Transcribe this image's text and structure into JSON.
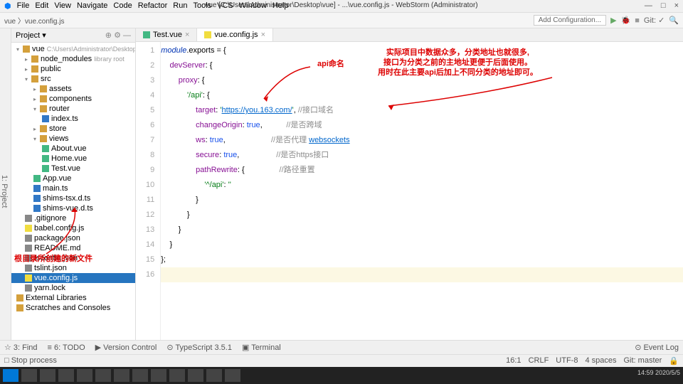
{
  "menu": [
    "File",
    "Edit",
    "View",
    "Navigate",
    "Code",
    "Refactor",
    "Run",
    "Tools",
    "VCS",
    "Window",
    "Help"
  ],
  "title": "vue [C:\\Users\\Administrator\\Desktop\\vue] - ...\\vue.config.js - WebStorm (Administrator)",
  "winbtns": [
    "—",
    "□",
    "×"
  ],
  "breadcrumb": "vue 〉vue.config.js",
  "addConfig": "Add Configuration...",
  "gitLabel": "Git: ✓",
  "projectHdr": "Project ▾",
  "tree": [
    {
      "d": 0,
      "i": "fld",
      "t": "vue",
      "sub": "C:\\Users\\Administrator\\Desktop\\vue",
      "a": "open"
    },
    {
      "d": 1,
      "i": "fld",
      "t": "node_modules",
      "sub": "library root",
      "lib": 1,
      "a": ""
    },
    {
      "d": 1,
      "i": "fld",
      "t": "public",
      "a": ""
    },
    {
      "d": 1,
      "i": "fld",
      "t": "src",
      "a": "open"
    },
    {
      "d": 2,
      "i": "fld",
      "t": "assets",
      "a": ""
    },
    {
      "d": 2,
      "i": "fld",
      "t": "components",
      "a": ""
    },
    {
      "d": 2,
      "i": "fld",
      "t": "router",
      "a": "open"
    },
    {
      "d": 3,
      "i": "fts",
      "t": "index.ts"
    },
    {
      "d": 2,
      "i": "fld",
      "t": "store",
      "a": ""
    },
    {
      "d": 2,
      "i": "fld",
      "t": "views",
      "a": "open"
    },
    {
      "d": 3,
      "i": "fvue",
      "t": "About.vue"
    },
    {
      "d": 3,
      "i": "fvue",
      "t": "Home.vue"
    },
    {
      "d": 3,
      "i": "fvue",
      "t": "Test.vue"
    },
    {
      "d": 2,
      "i": "fvue",
      "t": "App.vue"
    },
    {
      "d": 2,
      "i": "fts",
      "t": "main.ts"
    },
    {
      "d": 2,
      "i": "fts",
      "t": "shims-tsx.d.ts"
    },
    {
      "d": 2,
      "i": "fts",
      "t": "shims-vue.d.ts"
    },
    {
      "d": 1,
      "i": "fjson",
      "t": ".gitignore"
    },
    {
      "d": 1,
      "i": "fjs",
      "t": "babel.config.js"
    },
    {
      "d": 1,
      "i": "fjson",
      "t": "package.json"
    },
    {
      "d": 1,
      "i": "fjson",
      "t": "README.md"
    },
    {
      "d": 1,
      "i": "fjson",
      "t": "tsconfig.json"
    },
    {
      "d": 1,
      "i": "fjson",
      "t": "tslint.json"
    },
    {
      "d": 1,
      "i": "fjs",
      "t": "vue.config.js",
      "sel": 1
    },
    {
      "d": 1,
      "i": "fjson",
      "t": "yarn.lock"
    },
    {
      "d": 0,
      "i": "fld",
      "t": "External Libraries"
    },
    {
      "d": 0,
      "i": "fld",
      "t": "Scratches and Consoles"
    }
  ],
  "tabs": [
    {
      "label": "Test.vue",
      "active": false
    },
    {
      "label": "vue.config.js",
      "active": true
    }
  ],
  "code": [
    {
      "n": 1,
      "h": "<span class='kw'>module</span>.exports = {"
    },
    {
      "n": 2,
      "h": "    <span class='prop'>devServer</span>: {"
    },
    {
      "n": 3,
      "h": "        <span class='prop'>proxy</span>: {"
    },
    {
      "n": 4,
      "h": "            <span class='str'>'/api'</span>: {"
    },
    {
      "n": 5,
      "h": "                <span class='prop'>target</span>: <span class='str'>'</span><span class='lnk'>https://you.163.com/</span><span class='str'>'</span>, <span class='cmt'>//接口域名</span>"
    },
    {
      "n": 6,
      "h": "                <span class='prop'>changeOrigin</span>: <span class='num'>true</span>,           <span class='cmt'>//是否跨域</span>"
    },
    {
      "n": 7,
      "h": "                <span class='prop'>ws</span>: <span class='num'>true</span>,                     <span class='cmt'>//是否代理 <span class='lnk'>websockets</span></span>"
    },
    {
      "n": 8,
      "h": "                <span class='prop'>secure</span>: <span class='num'>true</span>,                 <span class='cmt'>//是否https接口</span>"
    },
    {
      "n": 9,
      "h": "                <span class='prop'>pathRewrite</span>: {                <span class='cmt'>//路径重置</span>"
    },
    {
      "n": 10,
      "h": "                    <span class='str'>'^/api'</span>: <span class='str'>''</span>"
    },
    {
      "n": 11,
      "h": "                }"
    },
    {
      "n": 12,
      "h": "            }"
    },
    {
      "n": 13,
      "h": "        }"
    },
    {
      "n": 14,
      "h": "    }"
    },
    {
      "n": 15,
      "h": "};"
    },
    {
      "n": 16,
      "h": "",
      "hl": 1
    }
  ],
  "anno": {
    "apiName": "api命名",
    "infoLine1": "实际项目中数据众多，分类地址也就很多,",
    "infoLine2": "接口为分类之前的主地址更便于后面使用。",
    "infoLine3": "用时在此主要api后加上不同分类的地址即可。",
    "newFile": "根目录所创建的新文件"
  },
  "bottom": [
    "☆ 3: Find",
    "≡ 6: TODO",
    "▶ Version Control",
    "⊙ TypeScript 3.5.1",
    "▣ Terminal"
  ],
  "eventLog": "⊙ Event Log",
  "status": {
    "msg": "□ Stop process",
    "pos": "16:1",
    "eol": "CRLF",
    "enc": "UTF-8",
    "indent": "4 spaces",
    "git": "Git: master"
  },
  "clock": "14:59\n2020/5/5"
}
